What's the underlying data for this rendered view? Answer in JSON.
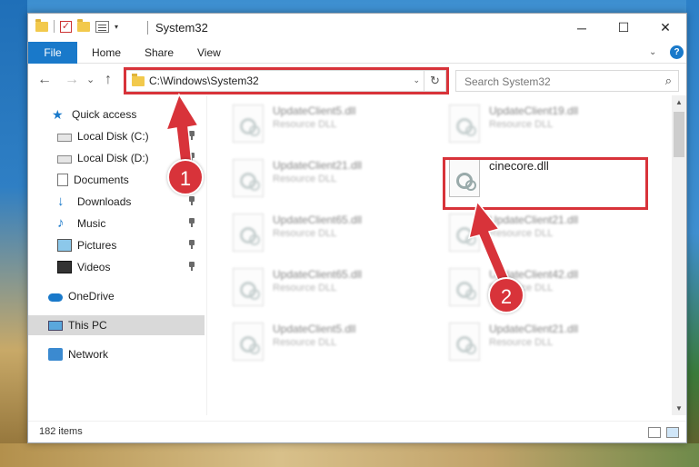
{
  "window": {
    "title": "System32",
    "controls": {
      "minimize": "─",
      "maximize": "☐",
      "close": "✕"
    }
  },
  "ribbon": {
    "tabs": [
      "File",
      "Home",
      "Share",
      "View"
    ],
    "help": "?"
  },
  "navbar": {
    "back": "←",
    "forward": "→",
    "recent": "⌄",
    "up": "↑",
    "address": "C:\\Windows\\System32",
    "refresh": "↻",
    "search_placeholder": "Search System32"
  },
  "sidebar": {
    "quick_access": "Quick access",
    "items": [
      {
        "label": "Local Disk (C:)",
        "icon": "disk-icon"
      },
      {
        "label": "Local Disk (D:)",
        "icon": "disk-icon"
      },
      {
        "label": "Documents",
        "icon": "documents-icon"
      },
      {
        "label": "Downloads",
        "icon": "downloads-icon"
      },
      {
        "label": "Music",
        "icon": "music-icon"
      },
      {
        "label": "Pictures",
        "icon": "pictures-icon"
      },
      {
        "label": "Videos",
        "icon": "videos-icon"
      }
    ],
    "onedrive": "OneDrive",
    "this_pc": "This PC",
    "network": "Network"
  },
  "files": [
    {
      "name": "UpdateClient5.dll",
      "type": "Resource DLL"
    },
    {
      "name": "UpdateClient19.dll",
      "type": "Resource DLL"
    },
    {
      "name": "UpdateClient21.dll",
      "type": "Resource DLL"
    },
    {
      "name": "cinecore.dll",
      "type": ""
    },
    {
      "name": "UpdateClient65.dll",
      "type": "Resource DLL"
    },
    {
      "name": "UpdateClient21.dll",
      "type": "Resource DLL"
    },
    {
      "name": "UpdateClient65.dll",
      "type": "Resource DLL"
    },
    {
      "name": "UpdateClient42.dll",
      "type": "Resource DLL"
    },
    {
      "name": "UpdateClient5.dll",
      "type": "Resource DLL"
    },
    {
      "name": "UpdateClient21.dll",
      "type": "Resource DLL"
    }
  ],
  "status": {
    "item_count": "182 items"
  },
  "annotations": {
    "step1": "1",
    "step2": "2",
    "highlight_color": "#d8333a"
  },
  "colors": {
    "accent": "#1979ca",
    "selection": "#d9d9d9"
  }
}
